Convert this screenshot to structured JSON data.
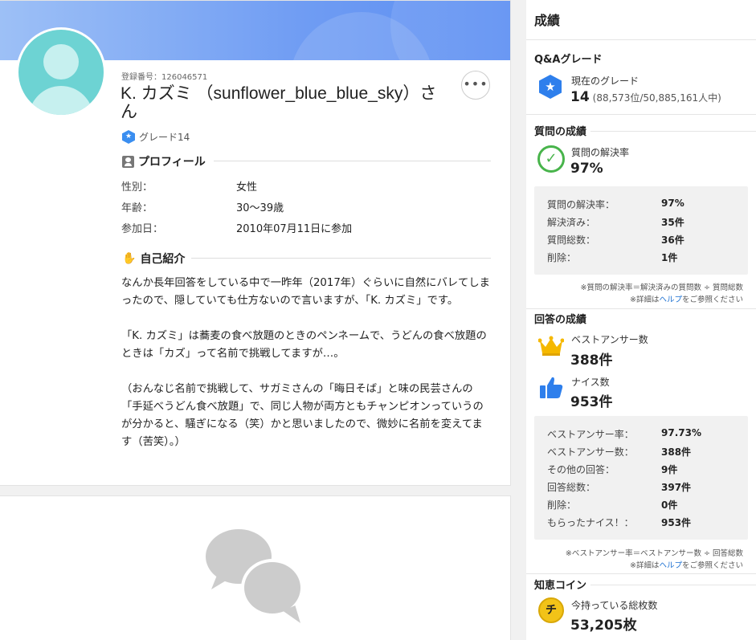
{
  "profile": {
    "reg_no": "登録番号：126046571",
    "name": "K. カズミ （sunflower_blue_blue_sky）さん",
    "more_label": "•••",
    "grade_label": "グレード14",
    "profile_heading": "プロフィール",
    "rows": [
      {
        "label": "性別：",
        "value": "女性"
      },
      {
        "label": "年齢：",
        "value": "30〜39歳"
      },
      {
        "label": "参加日：",
        "value": "2010年07月11日に参加"
      }
    ],
    "intro_heading": "自己紹介",
    "intro_text": "なんか長年回答をしている中で一昨年（2017年）ぐらいに自然にバレてしまったので、隠していても仕方ないので言いますが、「K. カズミ」です。\n\n「K. カズミ」は蕎麦の食べ放題のときのペンネームで、うどんの食べ放題のときは「カズ」って名前で挑戦してますが…。\n\n（おんなじ名前で挑戦して、サガミさんの「晦日そば」と味の民芸さんの「手延べうどん食べ放題」で、同じ人物が両方ともチャンピオンっていうのが分かると、騒ぎになる（笑）かと思いましたので、微妙に名前を変えてます（苦笑）。）"
  },
  "sidebar": {
    "title": "成績",
    "qa_grade": {
      "heading": "Q&Aグレード",
      "label": "現在のグレード",
      "value": "14",
      "rank": "(88,573位/50,885,161人中)",
      "icon_char": "★"
    },
    "questions": {
      "heading": "質問の成績",
      "label": "質問の解決率",
      "value": "97%",
      "icon_char": "✓",
      "stats": [
        {
          "label": "質問の解決率：",
          "value": "97%"
        },
        {
          "label": "解決済み：",
          "value": "35件"
        },
        {
          "label": "質問総数：",
          "value": "36件"
        },
        {
          "label": "削除：",
          "value": "1件"
        }
      ],
      "note": "※質問の解決率＝解決済みの質問数 ÷ 質問総数",
      "help_prefix": "※詳細は",
      "help_link": "ヘルプ",
      "help_suffix": "をご参照ください"
    },
    "answers": {
      "heading": "回答の成績",
      "best_label": "ベストアンサー数",
      "best_value": "388件",
      "nice_label": "ナイス数",
      "nice_value": "953件",
      "stats": [
        {
          "label": "ベストアンサー率：",
          "value": "97.73%"
        },
        {
          "label": "ベストアンサー数：",
          "value": "388件"
        },
        {
          "label": "その他の回答：",
          "value": "9件"
        },
        {
          "label": "回答総数：",
          "value": "397件"
        },
        {
          "label": "削除：",
          "value": "0件"
        },
        {
          "label": "もらったナイス！：",
          "value": "953件"
        }
      ],
      "note": "※ベストアンサー率＝ベストアンサー数 ÷ 回答総数",
      "help_prefix": "※詳細は",
      "help_link": "ヘルプ",
      "help_suffix": "をご参照ください"
    },
    "coins": {
      "heading": "知恵コイン",
      "label": "今持っている総枚数",
      "value": "53,205枚",
      "icon_char": "チ"
    }
  }
}
